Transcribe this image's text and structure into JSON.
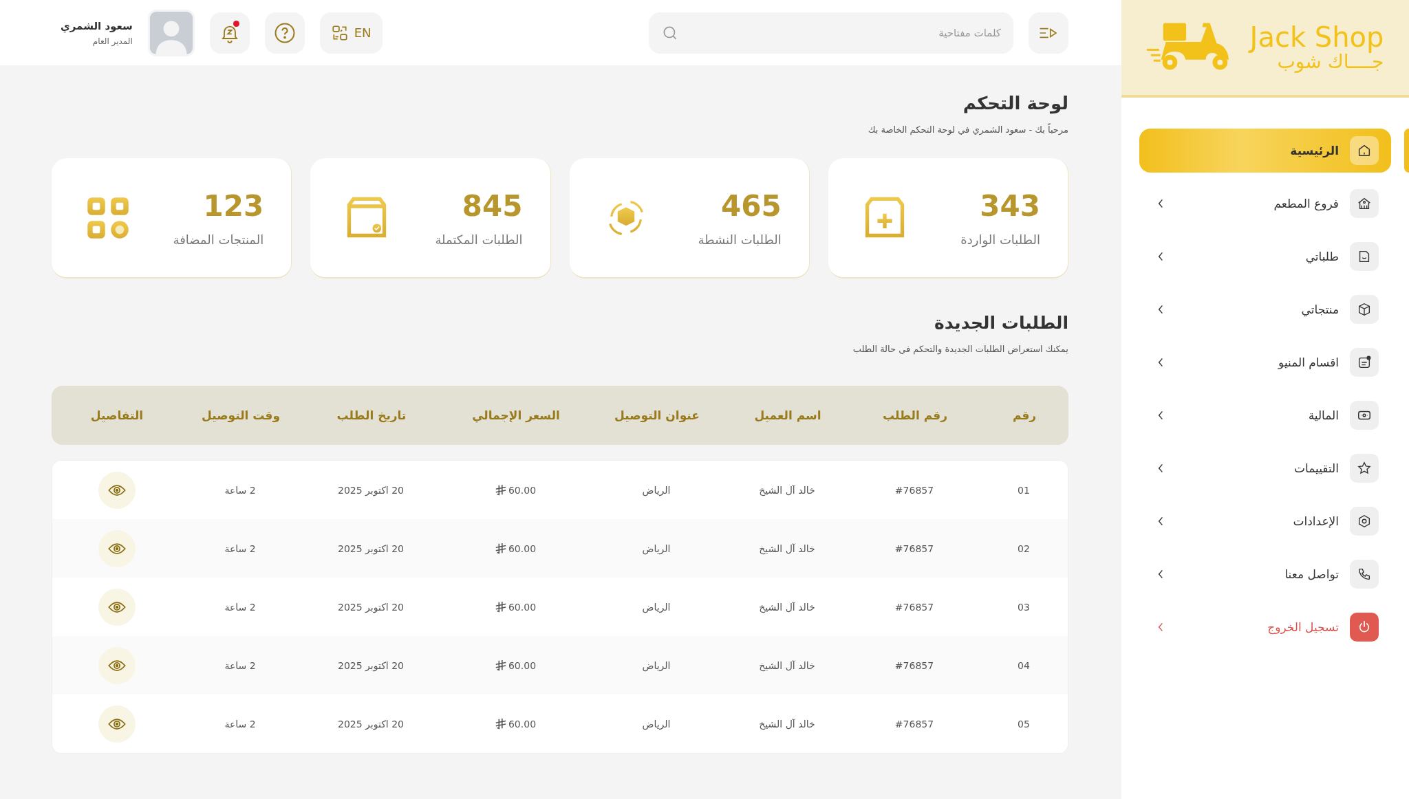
{
  "header": {
    "search": {
      "placeholder": "كلمات مفتاحية"
    },
    "language": "EN",
    "notifications": {
      "unread": true
    },
    "user": {
      "name": "سعود الشمري",
      "role": "المدير العام"
    }
  },
  "brand": {
    "name": "Jack Shop",
    "name_ar": "جــــاك شوب"
  },
  "sidebar": {
    "items": [
      {
        "label": "الرئيسية",
        "kind": "link",
        "selected": true
      },
      {
        "label": "فروع المطعم",
        "kind": "link",
        "selected": false
      },
      {
        "label": "طلباتي",
        "kind": "link",
        "selected": false
      },
      {
        "label": "منتجاتي",
        "kind": "link",
        "selected": false
      },
      {
        "label": "اقسام المنيو",
        "kind": "link",
        "selected": false
      },
      {
        "label": "المالية",
        "kind": "link",
        "selected": false
      },
      {
        "label": "التقييمات",
        "kind": "link",
        "selected": false
      },
      {
        "label": "الإعدادات",
        "kind": "link",
        "selected": false
      },
      {
        "label": "تواصل معنا",
        "kind": "link",
        "selected": false
      },
      {
        "label": "تسجيل الخروج",
        "kind": "logout",
        "selected": false
      }
    ]
  },
  "page": {
    "title": "لوحة التحكم",
    "subtitle": "مرحباً بك - سعود الشمري في لوحة التحكم الخاصة بك"
  },
  "stats": [
    {
      "value": "343",
      "label": "الطلبات الواردة"
    },
    {
      "value": "465",
      "label": "الطلبات النشطة"
    },
    {
      "value": "845",
      "label": "الطلبات المكتملة"
    },
    {
      "value": "123",
      "label": "المنتجات المضافة"
    }
  ],
  "orders": {
    "title": "الطلبات الجديدة",
    "subtitle": "يمكنك استعراض الطلبات الجديدة والتحكم في حالة الطلب",
    "columns": [
      "رقم",
      "رقم الطلب",
      "اسم العميل",
      "عنوان التوصيل",
      "السعر الإجمالي",
      "تاريخ الطلب",
      "وقت التوصيل",
      "التفاصيل"
    ],
    "rows": [
      {
        "number": "01",
        "order_id": "#76857",
        "customer": "خالد آل الشيخ",
        "address": "الرياض",
        "price": "60.00",
        "date": "20 اكتوبر 2025",
        "delivery_time": "2 ساعة"
      },
      {
        "number": "02",
        "order_id": "#76857",
        "customer": "خالد آل الشيخ",
        "address": "الرياض",
        "price": "60.00",
        "date": "20 اكتوبر 2025",
        "delivery_time": "2 ساعة"
      },
      {
        "number": "03",
        "order_id": "#76857",
        "customer": "خالد آل الشيخ",
        "address": "الرياض",
        "price": "60.00",
        "date": "20 اكتوبر 2025",
        "delivery_time": "2 ساعة"
      },
      {
        "number": "04",
        "order_id": "#76857",
        "customer": "خالد آل الشيخ",
        "address": "الرياض",
        "price": "60.00",
        "date": "20 اكتوبر 2025",
        "delivery_time": "2 ساعة"
      },
      {
        "number": "05",
        "order_id": "#76857",
        "customer": "خالد آل الشيخ",
        "address": "الرياض",
        "price": "60.00",
        "date": "20 اكتوبر 2025",
        "delivery_time": "2 ساعة"
      }
    ]
  }
}
